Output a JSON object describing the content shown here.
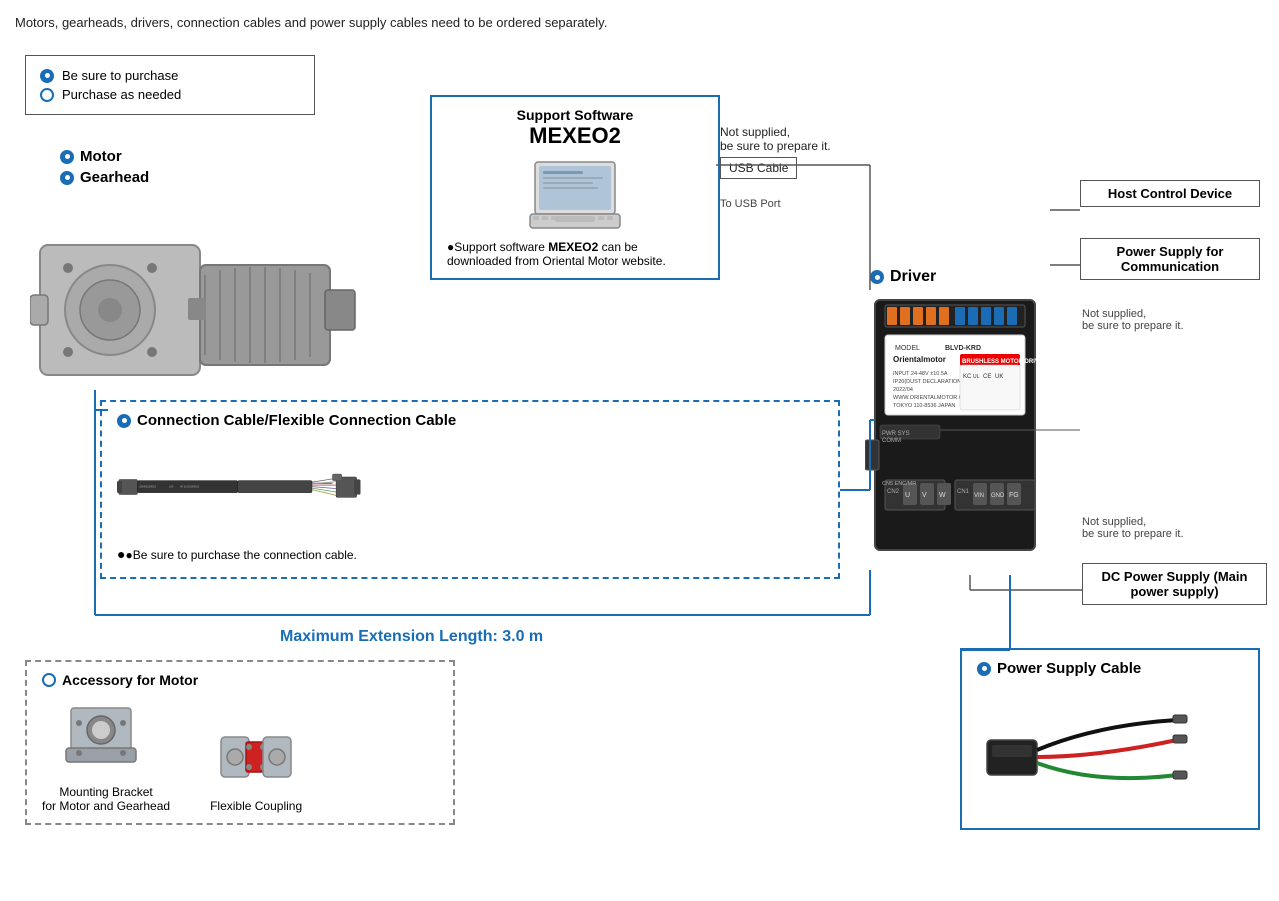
{
  "top_note": "Motors, gearheads, drivers, connection cables and power supply cables need to be ordered separately.",
  "legend": {
    "sure_label": "Be sure to purchase",
    "needed_label": "Purchase as needed"
  },
  "motor_section": {
    "motor_label": "Motor",
    "gearhead_label": "Gearhead"
  },
  "support_software": {
    "label": "Support Software",
    "name": "MEXEO2",
    "desc": "●Support software MEXEO2 can be downloaded from Oriental Motor website."
  },
  "usb": {
    "note_line1": "Not supplied,",
    "note_line2": "be sure to prepare it.",
    "box_label": "USB Cable",
    "to_usb": "To USB Port"
  },
  "connection_cable": {
    "label": "Connection Cable/Flexible Connection Cable",
    "note": "●Be sure to purchase the connection cable."
  },
  "driver": {
    "label": "Driver",
    "model": "BLVD-KRD",
    "brand": "Orientalmotor",
    "sub": "BRUSHLESS MOTOR DRIVER"
  },
  "host_control": {
    "label": "Host Control Device"
  },
  "power_comm": {
    "label": "Power Supply for Communication",
    "note_line1": "Not supplied,",
    "note_line2": "be sure to prepare it."
  },
  "dc_power": {
    "label": "DC Power Supply (Main power supply)",
    "note_line1": "Not supplied,",
    "note_line2": "be sure to prepare it."
  },
  "max_ext": {
    "label": "Maximum Extension Length: 3.0 m"
  },
  "accessory": {
    "label": "Accessory for Motor",
    "bracket_label": "Mounting Bracket\nfor Motor and Gearhead",
    "coupling_label": "Flexible Coupling"
  },
  "power_supply_cable": {
    "label": "Power Supply Cable"
  },
  "colors": {
    "blue": "#1a6db5",
    "dark": "#222",
    "gray": "#888"
  }
}
